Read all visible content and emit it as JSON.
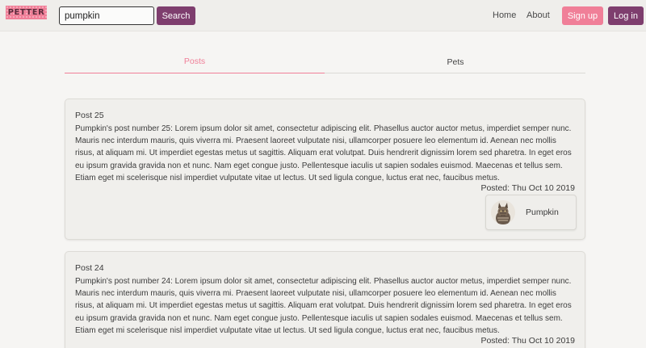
{
  "navbar": {
    "logo_text": "PETTER",
    "search_value": "pumpkin",
    "search_button": "Search",
    "links": [
      "Home",
      "About"
    ],
    "signup_label": "Sign up",
    "login_label": "Log in"
  },
  "tabs": [
    "Posts",
    "Pets"
  ],
  "active_tab": "Posts",
  "colors": {
    "brand_pink": "#f07f98",
    "brand_purple": "#7e3e6e"
  },
  "posts": [
    {
      "title": "Post 25",
      "body": "Pumpkin's post number 25: Lorem ipsum dolor sit amet, consectetur adipiscing elit. Phasellus auctor auctor metus, imperdiet semper nunc. Mauris nec interdum mauris, quis viverra mi. Praesent laoreet vulputate nisi, ullamcorper posuere leo elementum id. Aenean nec mollis risus, at aliquam mi. Ut imperdiet egestas metus ut sagittis. Aliquam erat volutpat. Duis hendrerit dignissim lorem sed pharetra. In eget eros eu ipsum gravida gravida non et nunc. Nam eget congue justo. Pellentesque iaculis ut sapien sodales euismod. Maecenas et tellus sem. Etiam eget mi scelerisque nisl imperdiet vulputate vitae ut lectus. Ut sed ligula congue, luctus erat nec, faucibus metus.",
      "date": "Posted: Thu Oct 10 2019",
      "pet_name": "Pumpkin"
    },
    {
      "title": "Post 24",
      "body": "Pumpkin's post number 24: Lorem ipsum dolor sit amet, consectetur adipiscing elit. Phasellus auctor auctor metus, imperdiet semper nunc. Mauris nec interdum mauris, quis viverra mi. Praesent laoreet vulputate nisi, ullamcorper posuere leo elementum id. Aenean nec mollis risus, at aliquam mi. Ut imperdiet egestas metus ut sagittis. Aliquam erat volutpat. Duis hendrerit dignissim lorem sed pharetra. In eget eros eu ipsum gravida gravida non et nunc. Nam eget congue justo. Pellentesque iaculis ut sapien sodales euismod. Maecenas et tellus sem. Etiam eget mi scelerisque nisl imperdiet vulputate vitae ut lectus. Ut sed ligula congue, luctus erat nec, faucibus metus.",
      "date": "Posted: Thu Oct 10 2019"
    }
  ]
}
